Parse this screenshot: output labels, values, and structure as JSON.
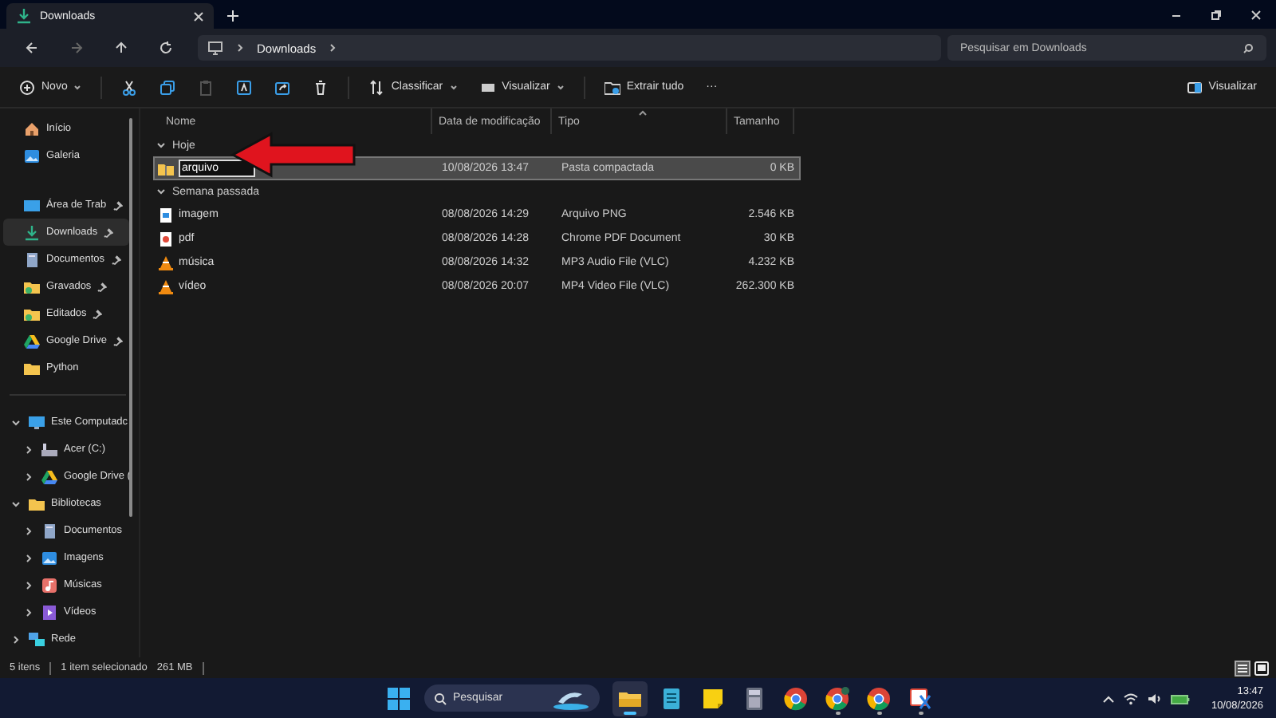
{
  "window": {
    "tab_title": "Downloads"
  },
  "address": {
    "path": [
      "Downloads"
    ],
    "search_placeholder": "Pesquisar em Downloads"
  },
  "toolbar": [
    {
      "kind": "new",
      "label": "Novo",
      "dropdown": true,
      "disabled": false
    },
    {
      "kind": "cut",
      "disabled": false
    },
    {
      "kind": "copy",
      "disabled": false
    },
    {
      "kind": "paste",
      "disabled": true
    },
    {
      "kind": "rename",
      "disabled": false
    },
    {
      "kind": "share",
      "disabled": false
    },
    {
      "kind": "delete",
      "disabled": false
    },
    {
      "kind": "sort",
      "label": "Classificar",
      "dropdown": true,
      "disabled": false
    },
    {
      "kind": "view",
      "label": "Visualizar",
      "dropdown": true,
      "disabled": false
    },
    {
      "kind": "extract",
      "label": "Extrair tudo",
      "dropdown": false,
      "disabled": false
    },
    {
      "kind": "more",
      "label": "···",
      "disabled": false
    }
  ],
  "preview_button": "Visualizar",
  "sidebar": {
    "top": [
      {
        "kind": "home",
        "label": "Início",
        "pinned": false,
        "selected": false
      },
      {
        "kind": "gallery",
        "label": "Galeria",
        "pinned": false,
        "selected": false
      }
    ],
    "quick_access": [
      {
        "kind": "desktop",
        "label": "Área de Trab",
        "pinned": true,
        "selected": false
      },
      {
        "kind": "download",
        "label": "Downloads",
        "pinned": true,
        "selected": true
      },
      {
        "kind": "docs",
        "label": "Documentos",
        "pinned": true,
        "selected": false
      },
      {
        "kind": "folder-green",
        "label": "Gravados",
        "pinned": true,
        "selected": false
      },
      {
        "kind": "folder-green",
        "label": "Editados",
        "pinned": true,
        "selected": false
      },
      {
        "kind": "gdrive",
        "label": "Google Drive",
        "pinned": true,
        "selected": false
      },
      {
        "kind": "folder",
        "label": "Python",
        "pinned": false,
        "selected": false
      }
    ],
    "tree": [
      {
        "kind": "pc",
        "label": "Este Computadc",
        "expanded": true,
        "children": [
          {
            "kind": "drive",
            "label": "Acer (C:)",
            "expanded": false
          },
          {
            "kind": "gdrive",
            "label": "Google Drive (",
            "expanded": false
          }
        ]
      },
      {
        "kind": "folder",
        "label": "Bibliotecas",
        "expanded": true,
        "children": [
          {
            "kind": "docs",
            "label": "Documentos",
            "expanded": false
          },
          {
            "kind": "gallery",
            "label": "Imagens",
            "expanded": false
          },
          {
            "kind": "music",
            "label": "Músicas",
            "expanded": false
          },
          {
            "kind": "video",
            "label": "Vídeos",
            "expanded": false
          }
        ]
      },
      {
        "kind": "network",
        "label": "Rede",
        "expanded": false
      }
    ]
  },
  "table": {
    "columns": [
      "Nome",
      "Data de modificação",
      "Tipo",
      "Tamanho"
    ],
    "groups": [
      {
        "label": "Hoje",
        "expanded": true,
        "rows": [
          {
            "kind": "zip",
            "name": "arquivo",
            "date": "10/08/2026 13:47",
            "type": "Pasta compactada",
            "size": "0 KB",
            "selected": true,
            "editing": true
          }
        ]
      },
      {
        "label": "Semana passada",
        "expanded": true,
        "rows": [
          {
            "kind": "png",
            "name": "imagem",
            "date": "08/08/2026 14:29",
            "type": "Arquivo PNG",
            "size": "2.546 KB",
            "selected": false,
            "editing": false
          },
          {
            "kind": "pdf",
            "name": "pdf",
            "date": "08/08/2026 14:28",
            "type": "Chrome PDF Document",
            "size": "30 KB",
            "selected": false,
            "editing": false
          },
          {
            "kind": "vlc",
            "name": "música",
            "date": "08/08/2026 14:32",
            "type": "MP3 Audio File (VLC)",
            "size": "4.232 KB",
            "selected": false,
            "editing": false
          },
          {
            "kind": "vlc",
            "name": "vídeo",
            "date": "08/08/2026 20:07",
            "type": "MP4 Video File (VLC)",
            "size": "262.300 KB",
            "selected": false,
            "editing": false
          }
        ]
      }
    ]
  },
  "status_bar": {
    "count": "5 itens",
    "selection": "1 item selecionado",
    "size": "261 MB"
  },
  "taskbar": {
    "search_placeholder": "Pesquisar",
    "apps": [
      {
        "kind": "explorer",
        "active": true,
        "running": true
      },
      {
        "kind": "notepad",
        "active": false,
        "running": false
      },
      {
        "kind": "sticky",
        "active": false,
        "running": false
      },
      {
        "kind": "calculator",
        "active": false,
        "running": false
      },
      {
        "kind": "chrome",
        "active": false,
        "running": false
      },
      {
        "kind": "chrome-badge",
        "active": false,
        "running": true
      },
      {
        "kind": "chrome",
        "active": false,
        "running": true
      },
      {
        "kind": "snip",
        "active": false,
        "running": true
      }
    ],
    "time": "13:47",
    "date": "10/08/2026"
  }
}
